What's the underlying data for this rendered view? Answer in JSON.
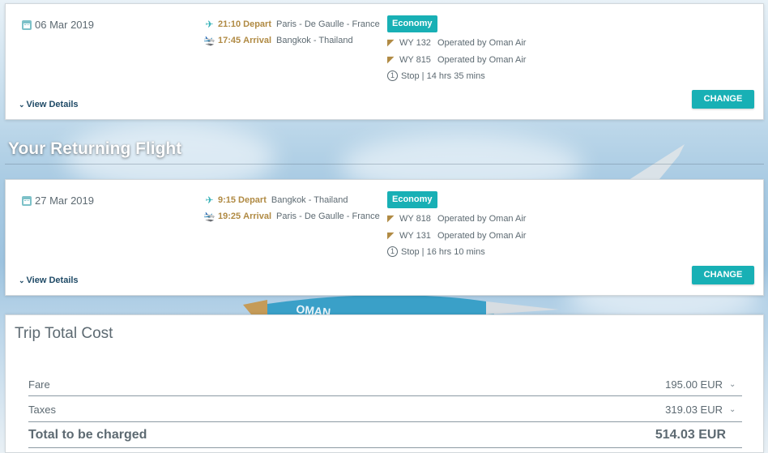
{
  "outbound": {
    "date": "06 Mar 2019",
    "depart": {
      "time": "21:10",
      "label": "Depart",
      "place": "Paris - De Gaulle - France"
    },
    "arrive": {
      "time": "17:45",
      "label": "Arrival",
      "place": "Bangkok - Thailand"
    },
    "cabin": "Economy",
    "segments": [
      {
        "flight": "WY 132",
        "operator": "Operated by Oman Air"
      },
      {
        "flight": "WY 815",
        "operator": "Operated by Oman Air"
      }
    ],
    "stop_info": "Stop | 14 hrs 35 mins",
    "view_details": "View Details",
    "change_label": "CHANGE"
  },
  "returning_heading": "Your Returning Flight",
  "inbound": {
    "date": "27 Mar 2019",
    "depart": {
      "time": "9:15",
      "label": "Depart",
      "place": "Bangkok - Thailand"
    },
    "arrive": {
      "time": "19:25",
      "label": "Arrival",
      "place": "Paris - De Gaulle - France"
    },
    "cabin": "Economy",
    "segments": [
      {
        "flight": "WY 818",
        "operator": "Operated by Oman Air"
      },
      {
        "flight": "WY 131",
        "operator": "Operated by Oman Air"
      }
    ],
    "stop_info": "Stop | 16 hrs 10 mins",
    "view_details": "View Details",
    "change_label": "CHANGE"
  },
  "cost": {
    "title": "Trip Total Cost",
    "rows": [
      {
        "label": "Fare",
        "amount": "195.00 EUR"
      },
      {
        "label": "Taxes",
        "amount": "319.03 EUR"
      }
    ],
    "total_label": "Total to be charged",
    "total_amount": "514.03 EUR"
  },
  "colors": {
    "accent": "#18b0b5",
    "gold": "#b08a43",
    "text": "#5d6a72",
    "link": "#1f4a66"
  },
  "icons": [
    "calendar-icon",
    "takeoff-icon",
    "landing-icon",
    "airline-tail-icon",
    "info-icon",
    "chevron-down-icon"
  ]
}
